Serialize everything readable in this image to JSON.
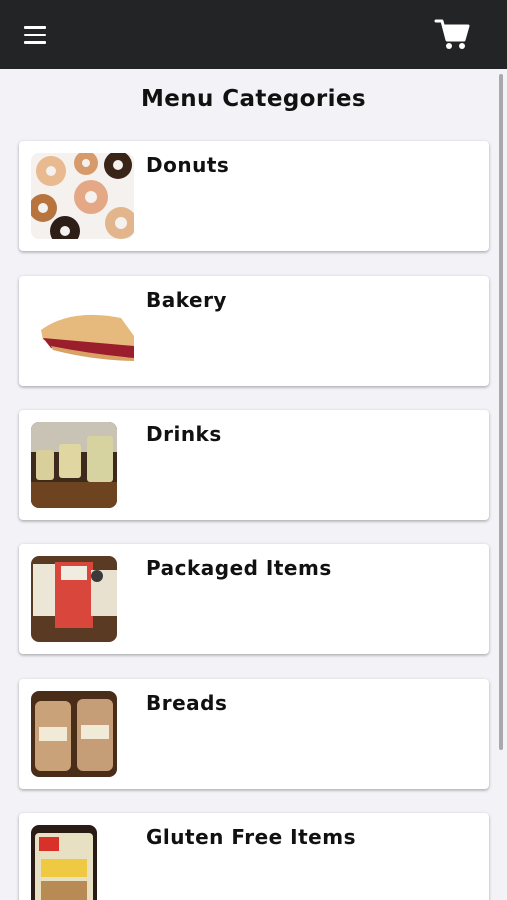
{
  "header": {
    "menu_icon": "hamburger-menu-icon",
    "cart_icon": "shopping-cart-icon",
    "background_color": "#222426"
  },
  "page": {
    "title": "Menu Categories"
  },
  "categories": [
    {
      "label": "Donuts",
      "image": "donuts"
    },
    {
      "label": "Bakery",
      "image": "cherry-pie-slice"
    },
    {
      "label": "Drinks",
      "image": "iced-drinks"
    },
    {
      "label": "Packaged Items",
      "image": "packaged-goods"
    },
    {
      "label": "Breads",
      "image": "bagged-breads"
    },
    {
      "label": "Gluten Free Items",
      "image": "gluten-free-package"
    }
  ]
}
